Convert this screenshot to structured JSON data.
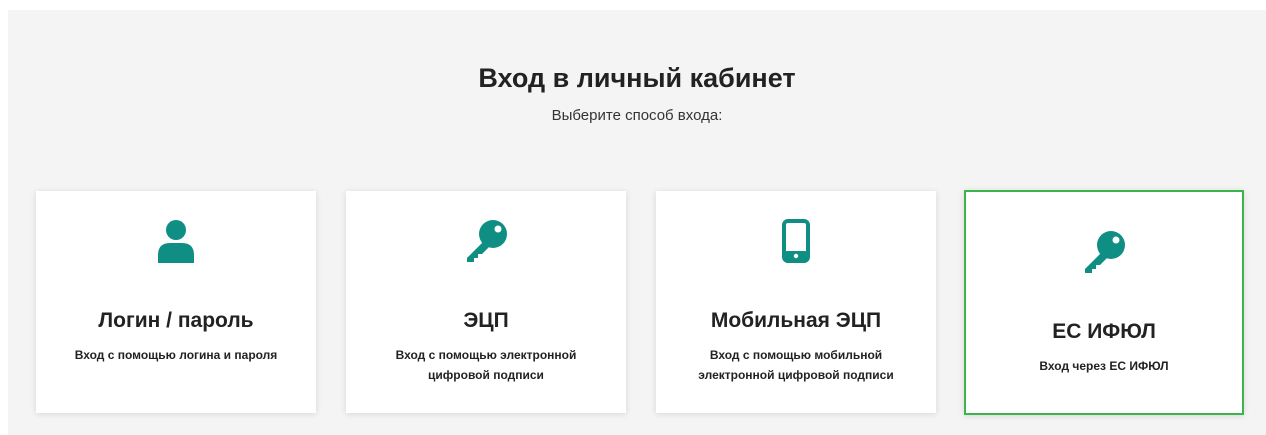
{
  "header": {
    "title": "Вход в личный кабинет",
    "subtitle": "Выберите способ входа:"
  },
  "accent_color": "#0f8f84",
  "selected_border_color": "#3bb54a",
  "cards": [
    {
      "icon": "user-icon",
      "title": "Логин / пароль",
      "desc": "Вход с помощью логина и пароля"
    },
    {
      "icon": "key-icon",
      "title": "ЭЦП",
      "desc": "Вход с помощью электронной цифровой подписи"
    },
    {
      "icon": "mobile-phone-icon",
      "title": "Мобильная ЭЦП",
      "desc": "Вход с помощью мобильной электронной цифровой подписи"
    },
    {
      "icon": "key-icon",
      "title": "ЕС ИФЮЛ",
      "desc": "Вход через ЕС ИФЮЛ",
      "selected": true
    }
  ]
}
